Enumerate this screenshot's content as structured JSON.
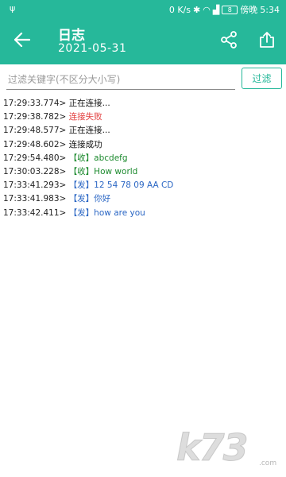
{
  "status_bar": {
    "usb_symbol": "ψ",
    "network_speed": "0 K/s",
    "battery_level": "8",
    "carrier": "傍晚",
    "time": "5:34"
  },
  "app_bar": {
    "title": "日志",
    "subtitle": "2021-05-31",
    "back_icon": "arrow-left-icon",
    "share_icon": "share-icon",
    "export_icon": "export-icon"
  },
  "filter": {
    "placeholder": "过滤关键字(不区分大小写)",
    "value": "",
    "button_label": "过滤"
  },
  "logs": [
    {
      "ts": "17:29:33.774>",
      "msg": "正在连接...",
      "type": "info"
    },
    {
      "ts": "17:29:38.782>",
      "msg": "连接失败",
      "type": "error"
    },
    {
      "ts": "17:29:48.577>",
      "msg": "正在连接...",
      "type": "info"
    },
    {
      "ts": "17:29:48.602>",
      "msg": "连接成功",
      "type": "info"
    },
    {
      "ts": "17:29:54.480>",
      "msg": "【收】abcdefg",
      "type": "recv"
    },
    {
      "ts": "17:30:03.228>",
      "msg": "【收】How world",
      "type": "recv"
    },
    {
      "ts": "17:33:41.293>",
      "msg": "【发】12 54 78 09 AA CD",
      "type": "send"
    },
    {
      "ts": "17:33:41.983>",
      "msg": "【发】你好",
      "type": "send"
    },
    {
      "ts": "17:33:42.411>",
      "msg": "【发】how are you",
      "type": "send"
    }
  ],
  "colors": {
    "accent": "#26b89a",
    "error": "#e23b3b",
    "recv": "#1c8a2e",
    "send": "#2a66c4"
  },
  "watermark": {
    "text": "k73",
    "sub": ".com"
  }
}
